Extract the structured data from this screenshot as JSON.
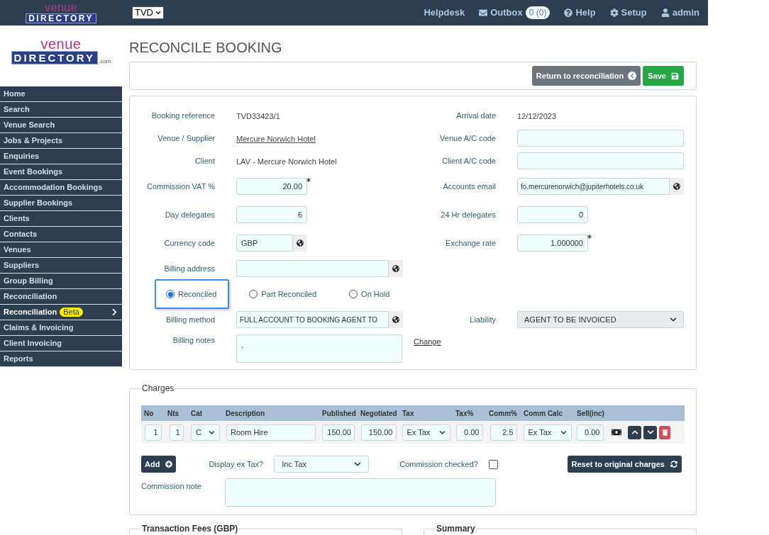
{
  "topbar": {
    "logo": {
      "top": "venue",
      "bottom": "DIRECTORY"
    },
    "site_select": "TVD",
    "links": [
      {
        "kind": "text",
        "label": "Helpdesk"
      },
      {
        "kind": "outbox",
        "label": "Outbox",
        "count": "0 (0)"
      },
      {
        "kind": "help",
        "label": "Help"
      },
      {
        "kind": "setup",
        "label": "Setup"
      },
      {
        "kind": "user",
        "label": "admin"
      }
    ]
  },
  "side_logo": {
    "top": "venue",
    "bottom": "DIRECTORY",
    "suffix": ".com"
  },
  "sidebar": {
    "items": [
      {
        "label": "Home",
        "selected": false
      },
      {
        "label": "Search",
        "selected": false
      },
      {
        "label": "Venue Search",
        "selected": false
      },
      {
        "label": "Jobs & Projects",
        "selected": false
      },
      {
        "label": "Enquiries",
        "selected": false
      },
      {
        "label": "Event Bookings",
        "selected": false
      },
      {
        "label": "Accommodation Bookings",
        "selected": false
      },
      {
        "label": "Supplier Bookings",
        "selected": false
      },
      {
        "label": "Clients",
        "selected": false
      },
      {
        "label": "Contacts",
        "selected": false
      },
      {
        "label": "Venues",
        "selected": false
      },
      {
        "label": "Suppliers",
        "selected": false
      },
      {
        "label": "Group Billing",
        "selected": false
      },
      {
        "label": "Reconciliation",
        "selected": false
      },
      {
        "label": "Reconciliation",
        "badge": "Beta",
        "selected": true
      },
      {
        "label": "Claims & Invoicing",
        "selected": false
      },
      {
        "label": "Client Invoicing",
        "selected": false
      },
      {
        "label": "Reports",
        "selected": false
      }
    ]
  },
  "page_title": "RECONCILE BOOKING",
  "toolbar": {
    "return_button": "Return to reconciliation",
    "save_button": "Save"
  },
  "form_rows": [
    {
      "left": {
        "label": "Booking reference",
        "kind": "text",
        "value": "TVD33423/1"
      },
      "right": {
        "label": "Arrival date",
        "kind": "text",
        "value": "12/12/2023"
      }
    },
    {
      "left": {
        "label": "Venue / Supplier",
        "kind": "link",
        "value": "Mercure Norwich Hotel"
      },
      "right": {
        "label": "Venue A/C code",
        "kind": "wide"
      }
    },
    {
      "left": {
        "label": "Client",
        "kind": "text",
        "value": "LAV - Mercure Norwich Hotel"
      },
      "right": {
        "label": "Client A/C code",
        "kind": "wide"
      }
    },
    {
      "left": {
        "label": "Commission VAT %",
        "kind": "number",
        "value": "20.00",
        "required": true
      },
      "right": {
        "label": "Accounts email",
        "kind": "globe_wide",
        "value": "fo.mercurenorwich@jupiterhotels.co.uk"
      }
    },
    {
      "left": {
        "label": "Day delegates",
        "kind": "number",
        "value": "6"
      },
      "right": {
        "label": "24 Hr delegates",
        "kind": "number",
        "value": "0"
      }
    },
    {
      "left": {
        "label": "Currency code",
        "kind": "globe_short",
        "value": "GBP"
      },
      "right": {
        "label": "Exchange rate",
        "kind": "number",
        "value": "1.000000",
        "required": true
      }
    },
    {
      "left": {
        "label": "Billing address",
        "kind": "globe_wide"
      }
    },
    {
      "kind": "radios",
      "options": [
        {
          "label": "Reconciled",
          "selected": true
        },
        {
          "label": "Part Reconciled",
          "selected": false
        },
        {
          "label": "On Hold",
          "selected": false
        }
      ]
    },
    {
      "left": {
        "label": "Billing method",
        "kind": "globe_wide",
        "value": "FULL ACCOUNT TO BOOKING AGENT TO"
      },
      "right": {
        "label": "Liability",
        "kind": "select",
        "value": "AGENT TO BE INVOICED"
      }
    },
    {
      "left": {
        "label": "Billing notes",
        "kind": "textarea",
        "value": "."
      },
      "right": {
        "kind": "action_link",
        "value": "Change"
      }
    }
  ],
  "charges": {
    "title": "Charges",
    "columns": [
      "No",
      "Nts",
      "Cat",
      "Description",
      "Published",
      "Negotiated",
      "Tax",
      "Tax%",
      "Comm%",
      "Comm Calc",
      "Sell(inc)"
    ],
    "rows": [
      {
        "cells": [
          {
            "kind": "num",
            "value": "1"
          },
          {
            "kind": "num",
            "value": "1"
          },
          {
            "kind": "select",
            "value": "C"
          },
          {
            "kind": "text",
            "value": "Room Hire"
          },
          {
            "kind": "num",
            "value": "150.00"
          },
          {
            "kind": "num",
            "value": "150.00"
          },
          {
            "kind": "select",
            "value": "Ex Tax"
          },
          {
            "kind": "num",
            "value": "0.00"
          },
          {
            "kind": "num",
            "value": "2.5"
          },
          {
            "kind": "select",
            "value": "Ex Tax"
          },
          {
            "kind": "num",
            "value": "0.00"
          }
        ]
      }
    ],
    "add_button": "Add",
    "display_label": "Display ex Tax?",
    "display_value": "Inc Tax",
    "commission_checked_label": "Commission checked?",
    "commission_checked": false,
    "reset_button": "Reset to original charges",
    "note_label": "Commission note"
  },
  "bottom_sections": [
    "Transaction Fees (GBP)",
    "Summary"
  ]
}
